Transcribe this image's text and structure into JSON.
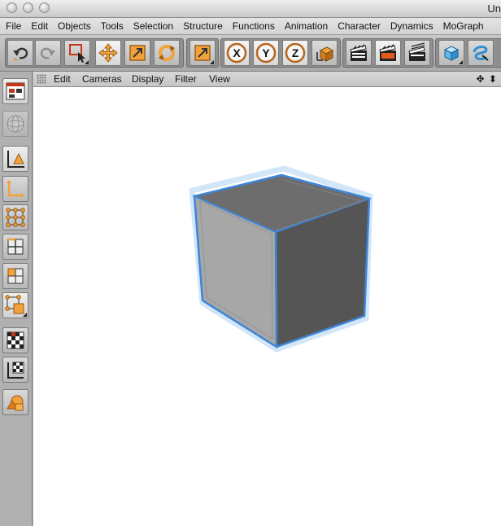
{
  "window": {
    "title": "Un"
  },
  "menu": [
    "File",
    "Edit",
    "Objects",
    "Tools",
    "Selection",
    "Structure",
    "Functions",
    "Animation",
    "Character",
    "Dynamics",
    "MoGraph"
  ],
  "toolbar": {
    "tools": [
      "undo",
      "redo",
      "live-selection",
      "move",
      "scale",
      "rotate",
      "last-tool",
      "x-axis",
      "y-axis",
      "z-axis",
      "coordinate-system",
      "render-active-view",
      "render-to-picture-viewer",
      "render-settings",
      "cube-primitive",
      "spline-pen"
    ],
    "axis_labels": {
      "x": "X",
      "y": "Y",
      "z": "Z"
    }
  },
  "left_palette": [
    "use-camera",
    "camera-sphere",
    "model-mode",
    "object-axis",
    "points-mode",
    "edges-mode",
    "polygons-mode",
    "uvw-mode",
    "texture-mode",
    "texture-axis",
    "sculpt-mode"
  ],
  "viewport": {
    "menu": {
      "edit": "Edit",
      "cameras": "Cameras",
      "display": "Display",
      "filter": "Filter",
      "view": "View"
    },
    "nav_icons": "✥ ⬍",
    "object": {
      "type": "cube",
      "selected": true,
      "highlight_color": "#3d86d8"
    }
  },
  "colors": {
    "accent": "#e8862a",
    "selection": "#3d86d8"
  }
}
